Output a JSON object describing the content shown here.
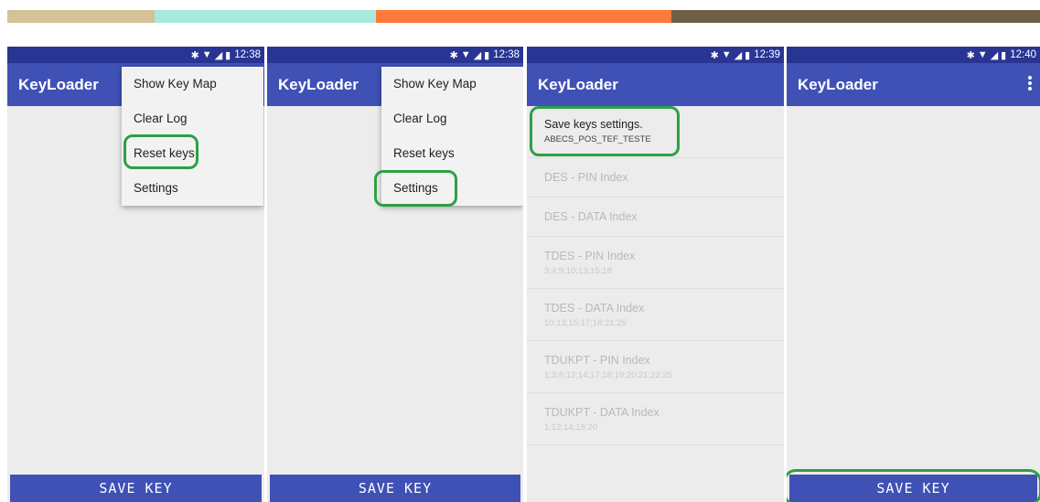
{
  "header_strip_colors": [
    "#d4c297",
    "#a8e9dc",
    "#ff7a3a",
    "#6e5f47"
  ],
  "colors": {
    "status_bar": "#283593",
    "app_bar": "#3f51b5",
    "highlight": "#2ea043"
  },
  "icons": [
    "bluetooth-icon",
    "wifi-icon",
    "signal-icon",
    "battery-icon",
    "more-vert-icon"
  ],
  "app_title": "KeyLoader",
  "save_key_label": "SAVE KEY",
  "screens": [
    {
      "time": "12:38",
      "menu": [
        "Show Key Map",
        "Clear Log",
        "Reset keys",
        "Settings"
      ],
      "highlighted": "Reset keys"
    },
    {
      "time": "12:38",
      "menu": [
        "Show Key Map",
        "Clear Log",
        "Reset keys",
        "Settings"
      ],
      "highlighted": "Settings"
    },
    {
      "time": "12:39"
    },
    {
      "time": "12:40",
      "highlighted": "SAVE KEY"
    }
  ],
  "settings": [
    {
      "title": "Save keys settings.",
      "summary": "ABECS_POS_TEF_TESTE"
    },
    {
      "title": "DES - PIN Index",
      "summary": ""
    },
    {
      "title": "DES - DATA Index",
      "summary": ""
    },
    {
      "title": "TDES - PIN Index",
      "summary": "3;4;9;10;13;15;18"
    },
    {
      "title": "TDES - DATA Index",
      "summary": "10;13;15;17;18;21;25"
    },
    {
      "title": "TDUKPT - PIN Index",
      "summary": "1;3;8;12;14;17;18;19;20;21;22;25"
    },
    {
      "title": "TDUKPT - DATA Index",
      "summary": "1;12;14;18;20"
    }
  ]
}
